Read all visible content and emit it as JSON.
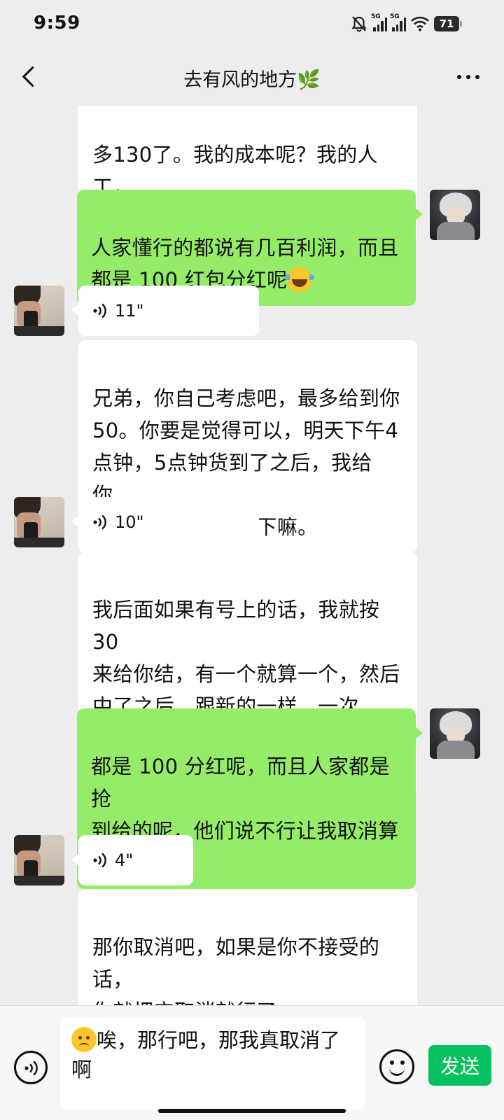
{
  "status_bar": {
    "time": "9:59",
    "signal_labels": [
      "5G",
      "5G"
    ],
    "battery_level": "71",
    "icons": [
      "mute-bell-icon",
      "signal-5g-icon",
      "signal-5g-icon",
      "wifi-icon",
      "battery-icon"
    ]
  },
  "header": {
    "title": "去有风的地方🌿",
    "back_icon": "chevron-left-icon",
    "more_icon": "more-dots-icon"
  },
  "messages": [
    {
      "from": "peer",
      "type": "text",
      "text": "多130了。我的成本呢？我的人工，\n我下来根本不挣钱，是不是？"
    },
    {
      "from": "me",
      "type": "text",
      "text": "人家懂行的都说有几百利润，而且\n都是 100 红包分红呢",
      "emoji": "laughing-tears-emoji"
    },
    {
      "from": "peer",
      "type": "voice",
      "duration": "11\""
    },
    {
      "from": "peer",
      "type": "text",
      "text": "兄弟，你自己考虑吧，最多给到你\n50。你要是觉得可以，明天下午4\n点钟，5点钟货到了之后，我给你，\n然后你配合我收一下嘛。"
    },
    {
      "from": "peer",
      "type": "voice",
      "duration": "10\""
    },
    {
      "from": "peer",
      "type": "text",
      "text": "我后面如果有号上的话，我就按30\n来给你结，有一个就算一个，然后\n中了之后，跟新的一样，一次50。\n只要中一单，我就给你50。"
    },
    {
      "from": "me",
      "type": "text",
      "text": "都是 100 分红呢，而且人家都是抢\n到给的呢，他们说不行让我取消算\n了",
      "emoji": "crying-laughing-emoji"
    },
    {
      "from": "peer",
      "type": "voice",
      "duration": "4\""
    },
    {
      "from": "peer",
      "type": "text",
      "text": "那你取消吧，如果是你不接受的话，\n你就把它取消就行了。"
    }
  ],
  "input": {
    "value": "唉，那行吧，那我真取消了\n啊",
    "emoji": "sad-face-emoji",
    "send_label": "发送"
  },
  "colors": {
    "background": "#ededed",
    "my_bubble": "#95ec69",
    "peer_bubble": "#ffffff",
    "send_button": "#07c160"
  }
}
